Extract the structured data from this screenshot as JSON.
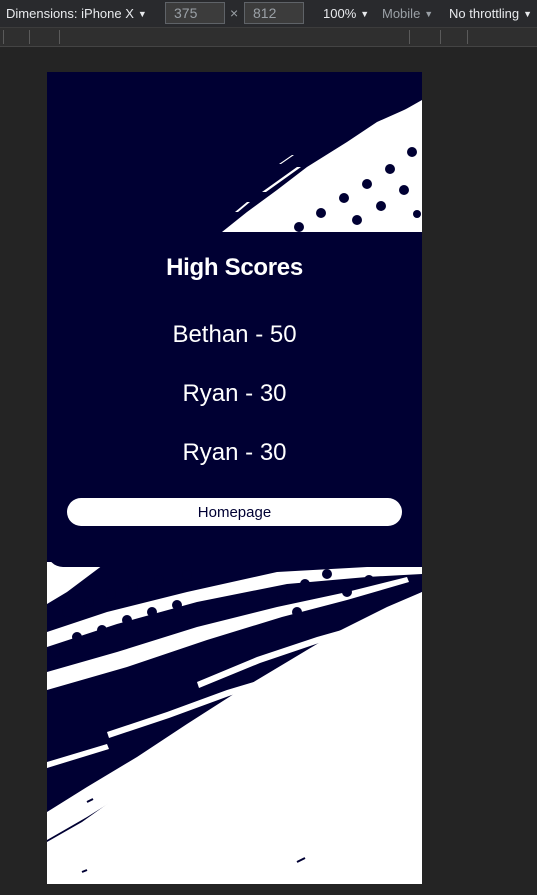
{
  "devtools": {
    "dimensions_label": "Dimensions: iPhone X",
    "width": "375",
    "times": "×",
    "height": "812",
    "zoom": "100%",
    "mode": "Mobile",
    "throttling": "No throttling"
  },
  "page": {
    "title": "High Scores",
    "scores": [
      "Bethan - 50",
      "Ryan - 30",
      "Ryan - 30"
    ],
    "home_button": "Homepage"
  },
  "colors": {
    "navy": "#000033",
    "white": "#ffffff"
  }
}
